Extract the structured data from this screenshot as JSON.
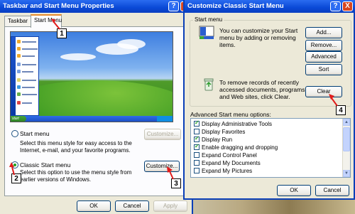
{
  "win1": {
    "title": "Taskbar and Start Menu Properties",
    "tabs": [
      "Taskbar",
      "Start Menu"
    ],
    "preview": {
      "start_label": "start"
    },
    "start_menu_option": {
      "label": "Start menu",
      "description": "Select this menu style for easy access to the Internet, e-mail, and your favorite programs.",
      "button": "Customize..."
    },
    "classic_option": {
      "label": "Classic Start menu",
      "description": "Select this option to use the menu style from earlier versions of Windows.",
      "button": "Customize..."
    },
    "buttons": {
      "ok": "OK",
      "cancel": "Cancel",
      "apply": "Apply"
    }
  },
  "win2": {
    "title": "Customize Classic Start Menu",
    "group_title": "Start menu",
    "customize_text": "You can customize your Start menu by adding or removing items.",
    "clear_text": "To remove records of recently accessed documents, programs, and Web sites, click Clear.",
    "buttons": {
      "add": "Add...",
      "remove": "Remove...",
      "advanced": "Advanced",
      "sort": "Sort",
      "clear": "Clear",
      "ok": "OK",
      "cancel": "Cancel"
    },
    "options_title": "Advanced Start menu options:",
    "options": [
      {
        "label": "Display Administrative Tools",
        "checked": true
      },
      {
        "label": "Display Favorites",
        "checked": false
      },
      {
        "label": "Display Run",
        "checked": true
      },
      {
        "label": "Enable dragging and dropping",
        "checked": true
      },
      {
        "label": "Expand Control Panel",
        "checked": false
      },
      {
        "label": "Expand My Documents",
        "checked": false
      },
      {
        "label": "Expand My Pictures",
        "checked": false
      }
    ]
  },
  "callouts": [
    "1",
    "2",
    "3",
    "4"
  ],
  "help_glyph": "?",
  "close_glyph": "X",
  "colors": {
    "title_blue": "#0a49d6",
    "callout_arrow": "#e11b1b",
    "radio_green": "#21a121"
  }
}
